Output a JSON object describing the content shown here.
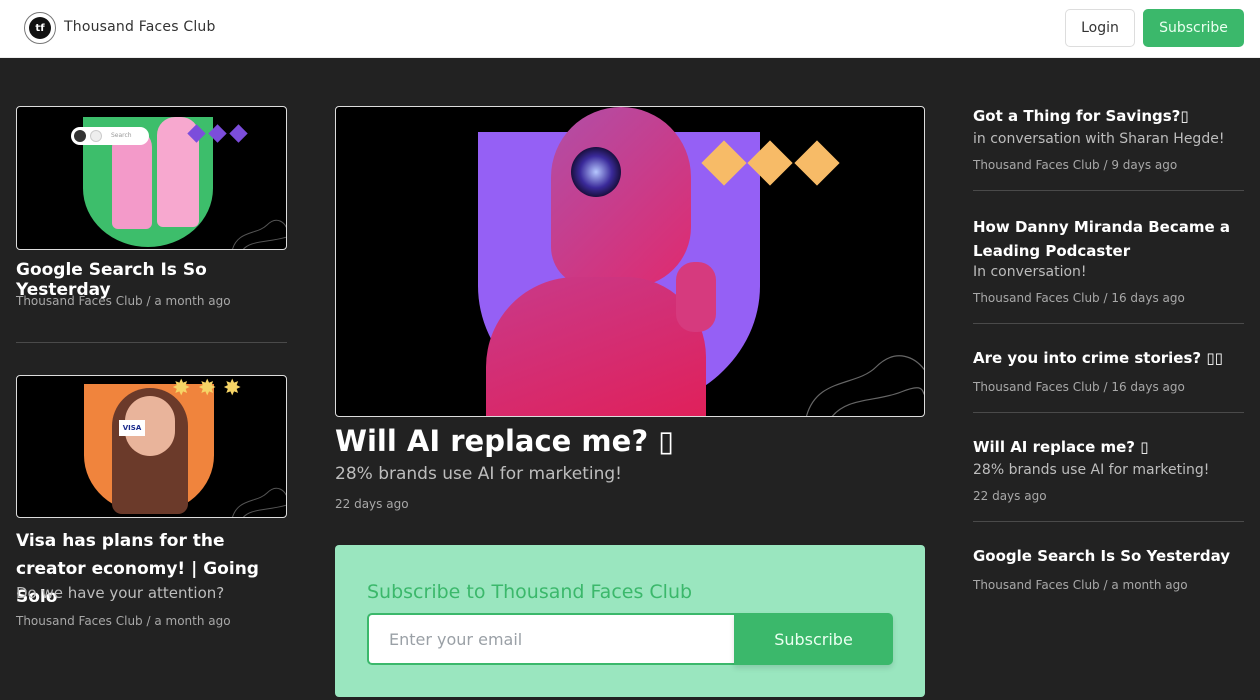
{
  "header": {
    "logo_text": "tf",
    "brand": "Thousand Faces Club",
    "login_label": "Login",
    "subscribe_label": "Subscribe"
  },
  "left_posts": [
    {
      "title": "Google Search Is So Yesterday",
      "meta": "Thousand Faces Club / a month ago",
      "image": "two-women-phones-green-shield",
      "image_search_label": "Search"
    },
    {
      "title": "Visa has plans for the creator economy! | Going Solo",
      "subtitle": "Do we have your attention?",
      "meta": "Thousand Faces Club / a month ago",
      "image": "woman-visa-card-orange-shield",
      "image_card_label": "VISA"
    }
  ],
  "featured": {
    "title": "Will AI replace me? ▯",
    "subtitle": "28% brands use AI for marketing!",
    "meta": "22 days ago",
    "image": "robot-purple-shield"
  },
  "subscribe_box": {
    "title": "Subscribe to Thousand Faces Club",
    "email_placeholder": "Enter your email",
    "email_value": "",
    "button_label": "Subscribe"
  },
  "right_posts": [
    {
      "title": "Got a Thing for Savings?▯",
      "subtitle": "in conversation with Sharan Hegde!",
      "meta": "Thousand Faces Club / 9 days ago"
    },
    {
      "title": "How Danny Miranda Became a Leading Podcaster",
      "subtitle": "In conversation!",
      "meta": "Thousand Faces Club / 16 days ago"
    },
    {
      "title": "Are you into crime stories? ▯▯",
      "meta": "Thousand Faces Club / 16 days ago"
    },
    {
      "title": "Will AI replace me? ▯",
      "subtitle": "28% brands use AI for marketing!",
      "meta": "22 days ago"
    },
    {
      "title": "Google Search Is So Yesterday",
      "meta": "Thousand Faces Club / a month ago"
    }
  ],
  "colors": {
    "accent_green": "#3bb86b",
    "subscribe_box_bg": "#9ae6bf",
    "page_bg": "#222222"
  }
}
